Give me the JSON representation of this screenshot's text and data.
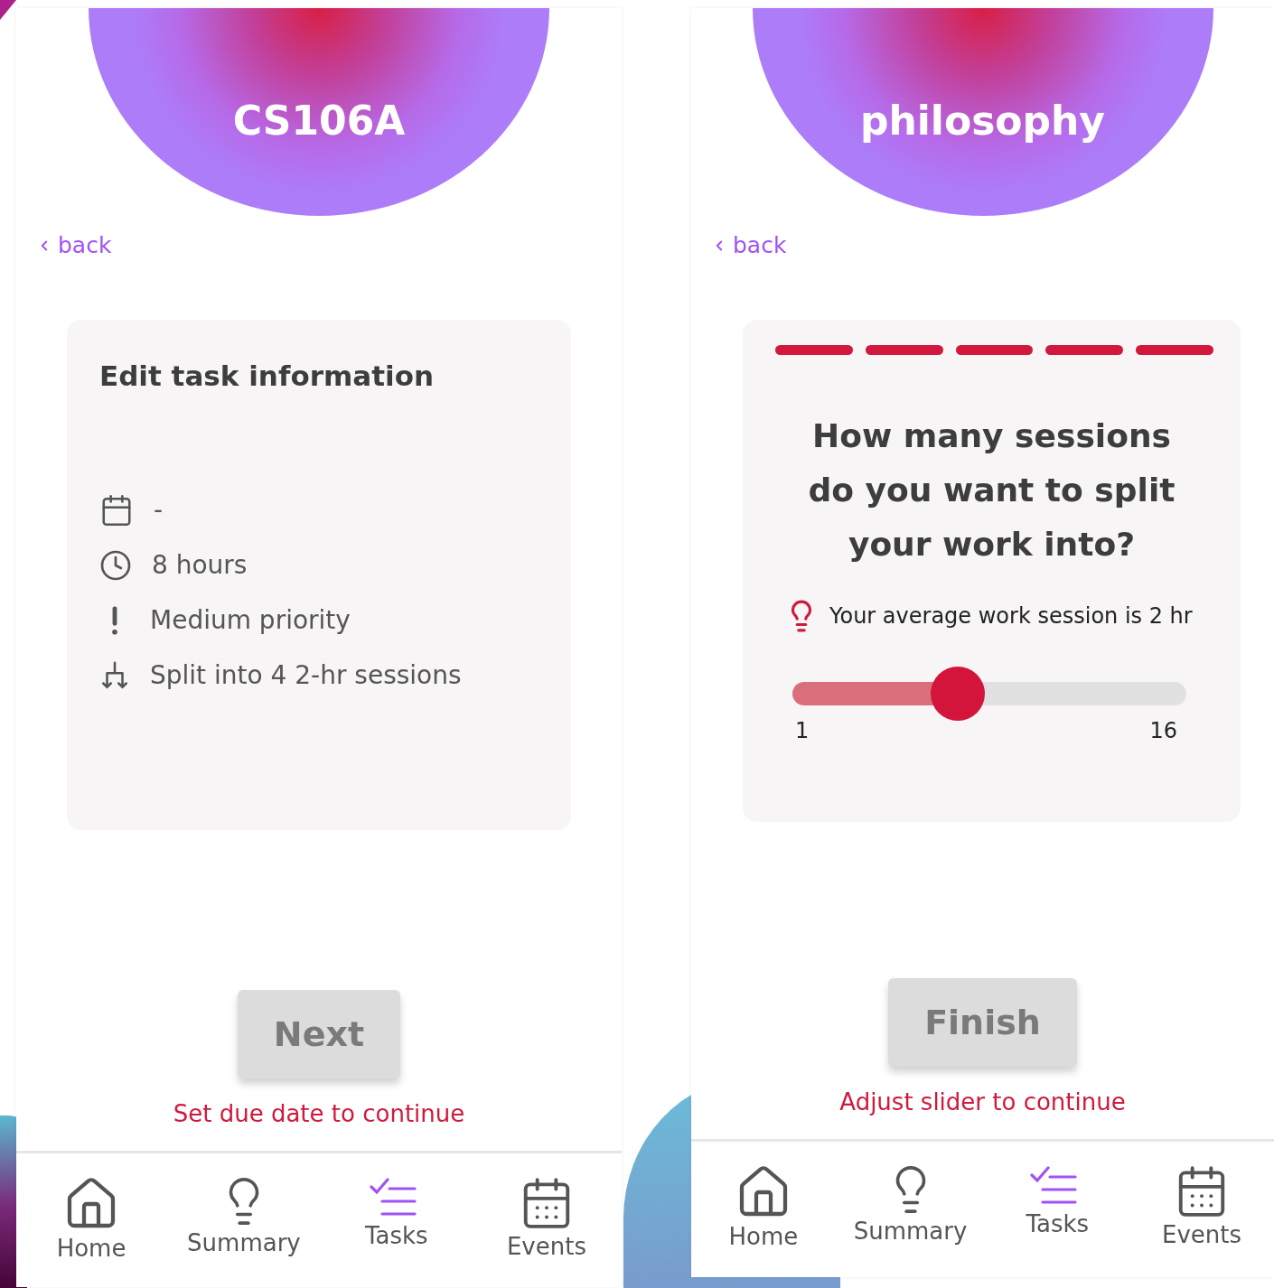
{
  "screens": [
    {
      "kind": "info",
      "course": "CS106A",
      "back": "back",
      "card": {
        "title": "Edit task information",
        "rows": [
          {
            "kind": "date",
            "text": "-"
          },
          {
            "kind": "duration",
            "text": "8 hours"
          },
          {
            "kind": "priority",
            "text": "Medium priority"
          },
          {
            "kind": "split",
            "text": "Split into 4 2-hr sessions"
          }
        ]
      },
      "button": {
        "label": "Next",
        "disabled": true
      },
      "hint": "Set due date to continue",
      "nav": [
        {
          "kind": "home",
          "label": "Home",
          "selected": false
        },
        {
          "kind": "summary",
          "label": "Summary",
          "selected": false
        },
        {
          "kind": "tasks",
          "label": "Tasks",
          "selected": true
        },
        {
          "kind": "events",
          "label": "Events",
          "selected": false
        }
      ]
    },
    {
      "kind": "slider",
      "course": "philosophy",
      "back": "back",
      "card": {
        "steps": [
          {
            "done": true
          },
          {
            "done": true
          },
          {
            "done": true
          },
          {
            "done": true
          },
          {
            "done": true
          }
        ],
        "question": "How many sessions do you want to split your work into?",
        "tip": "Your average work session is 2 hr",
        "slider": {
          "level": 0.42,
          "min": "1",
          "max": "16"
        }
      },
      "button": {
        "label": "Finish",
        "disabled": true
      },
      "hint": "Adjust slider to continue",
      "nav": [
        {
          "kind": "home",
          "label": "Home",
          "selected": false
        },
        {
          "kind": "summary",
          "label": "Summary",
          "selected": false
        },
        {
          "kind": "tasks",
          "label": "Tasks",
          "selected": true
        },
        {
          "kind": "events",
          "label": "Events",
          "selected": false
        }
      ]
    }
  ]
}
